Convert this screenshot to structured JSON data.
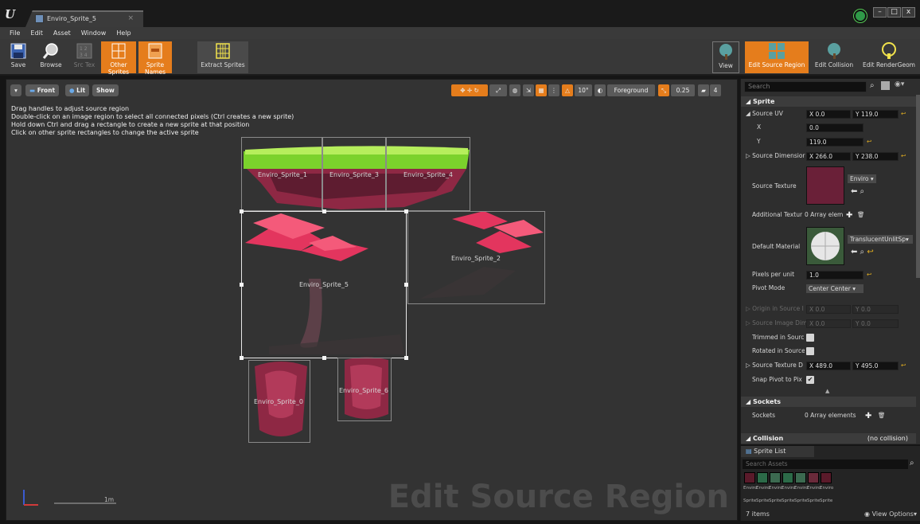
{
  "window": {
    "tab_title": "Enviro_Sprite_5",
    "tab_close": "×",
    "minimize": "–",
    "maximize": "□",
    "close": "x"
  },
  "menu": [
    "File",
    "Edit",
    "Asset",
    "Window",
    "Help"
  ],
  "toolbar": {
    "save": "Save",
    "browse": "Browse",
    "src_tex": "Src Tex",
    "other_sprites": "Other Sprites",
    "sprite_names": "Sprite Names",
    "extract_sprites": "Extract Sprites",
    "view": "View",
    "edit_source_region": "Edit Source Region",
    "edit_collision": "Edit Collision",
    "edit_render_geom": "Edit RenderGeom"
  },
  "viewport": {
    "view_front": "Front",
    "view_lit": "Lit",
    "view_show": "Show",
    "help_lines": [
      "Drag handles to adjust source region",
      "Double-click on an image region to select all connected pixels (Ctrl creates a new sprite)",
      "Hold down Ctrl and drag a rectangle to create a new sprite at that position",
      "Click on other sprite rectangles to change the active sprite"
    ],
    "rot_snap": "10°",
    "layer": "Foreground",
    "scale_snap": "0.25",
    "cam_speed": "4",
    "scale_label": "1m",
    "mode_overlay": "Edit Source Region",
    "sprite_labels": {
      "s1": "Enviro_Sprite_1",
      "s3": "Enviro_Sprite_3",
      "s4": "Enviro_Sprite_4",
      "s5": "Enviro_Sprite_5",
      "s2": "Enviro_Sprite_2",
      "s0": "Enviro_Sprite_0",
      "s6": "Enviro_Sprite_6"
    }
  },
  "details": {
    "search_placeholder": "Search",
    "sprite_header": "Sprite",
    "source_uv": {
      "label": "Source UV",
      "x": "X  0.0",
      "y": "Y  119.0",
      "sub_x_label": "X",
      "sub_x": "0.0",
      "sub_y_label": "Y",
      "sub_y": "119.0"
    },
    "source_dimension": {
      "label": "Source Dimensior",
      "x": "X  266.0",
      "y": "Y  238.0"
    },
    "source_texture": {
      "label": "Source Texture",
      "value": "Enviro"
    },
    "additional_textures": {
      "label": "Additional Textur",
      "value": "0 Array elem"
    },
    "default_material": {
      "label": "Default Material",
      "value": "TranslucentUnlitSp"
    },
    "pixels_per_unit": {
      "label": "Pixels per unit",
      "value": "1.0"
    },
    "pivot_mode": {
      "label": "Pivot Mode",
      "value": "Center Center"
    },
    "origin_in_source": {
      "label": "Origin in Source I",
      "x": "X  0.0",
      "y": "Y  0.0"
    },
    "source_image_dim": {
      "label": "Source Image Dim",
      "x": "X  0.0",
      "y": "Y  0.0"
    },
    "trimmed": {
      "label": "Trimmed in Sourc"
    },
    "rotated": {
      "label": "Rotated in Source"
    },
    "source_texture_dim": {
      "label": "Source Texture D",
      "x": "X  489.0",
      "y": "Y  495.0"
    },
    "snap_pivot": {
      "label": "Snap Pivot to Pix",
      "checked": true
    },
    "sockets_header": "Sockets",
    "sockets": {
      "label": "Sockets",
      "value": "0 Array elements"
    },
    "collision_header": "Collision",
    "collision_value": "(no collision)"
  },
  "sprite_list": {
    "tab": "Sprite List",
    "search_placeholder": "Search Assets",
    "thumb_labels": [
      "Enviro",
      "Enviro",
      "Enviro",
      "Enviro",
      "Enviro",
      "Enviro",
      "Enviro"
    ],
    "thumb_labels2": [
      "Sprite",
      "Sprite",
      "Sprite",
      "Sprite",
      "Sprite",
      "Sprite",
      "Sprite"
    ],
    "count": "7 items",
    "view_options": "View Options"
  }
}
